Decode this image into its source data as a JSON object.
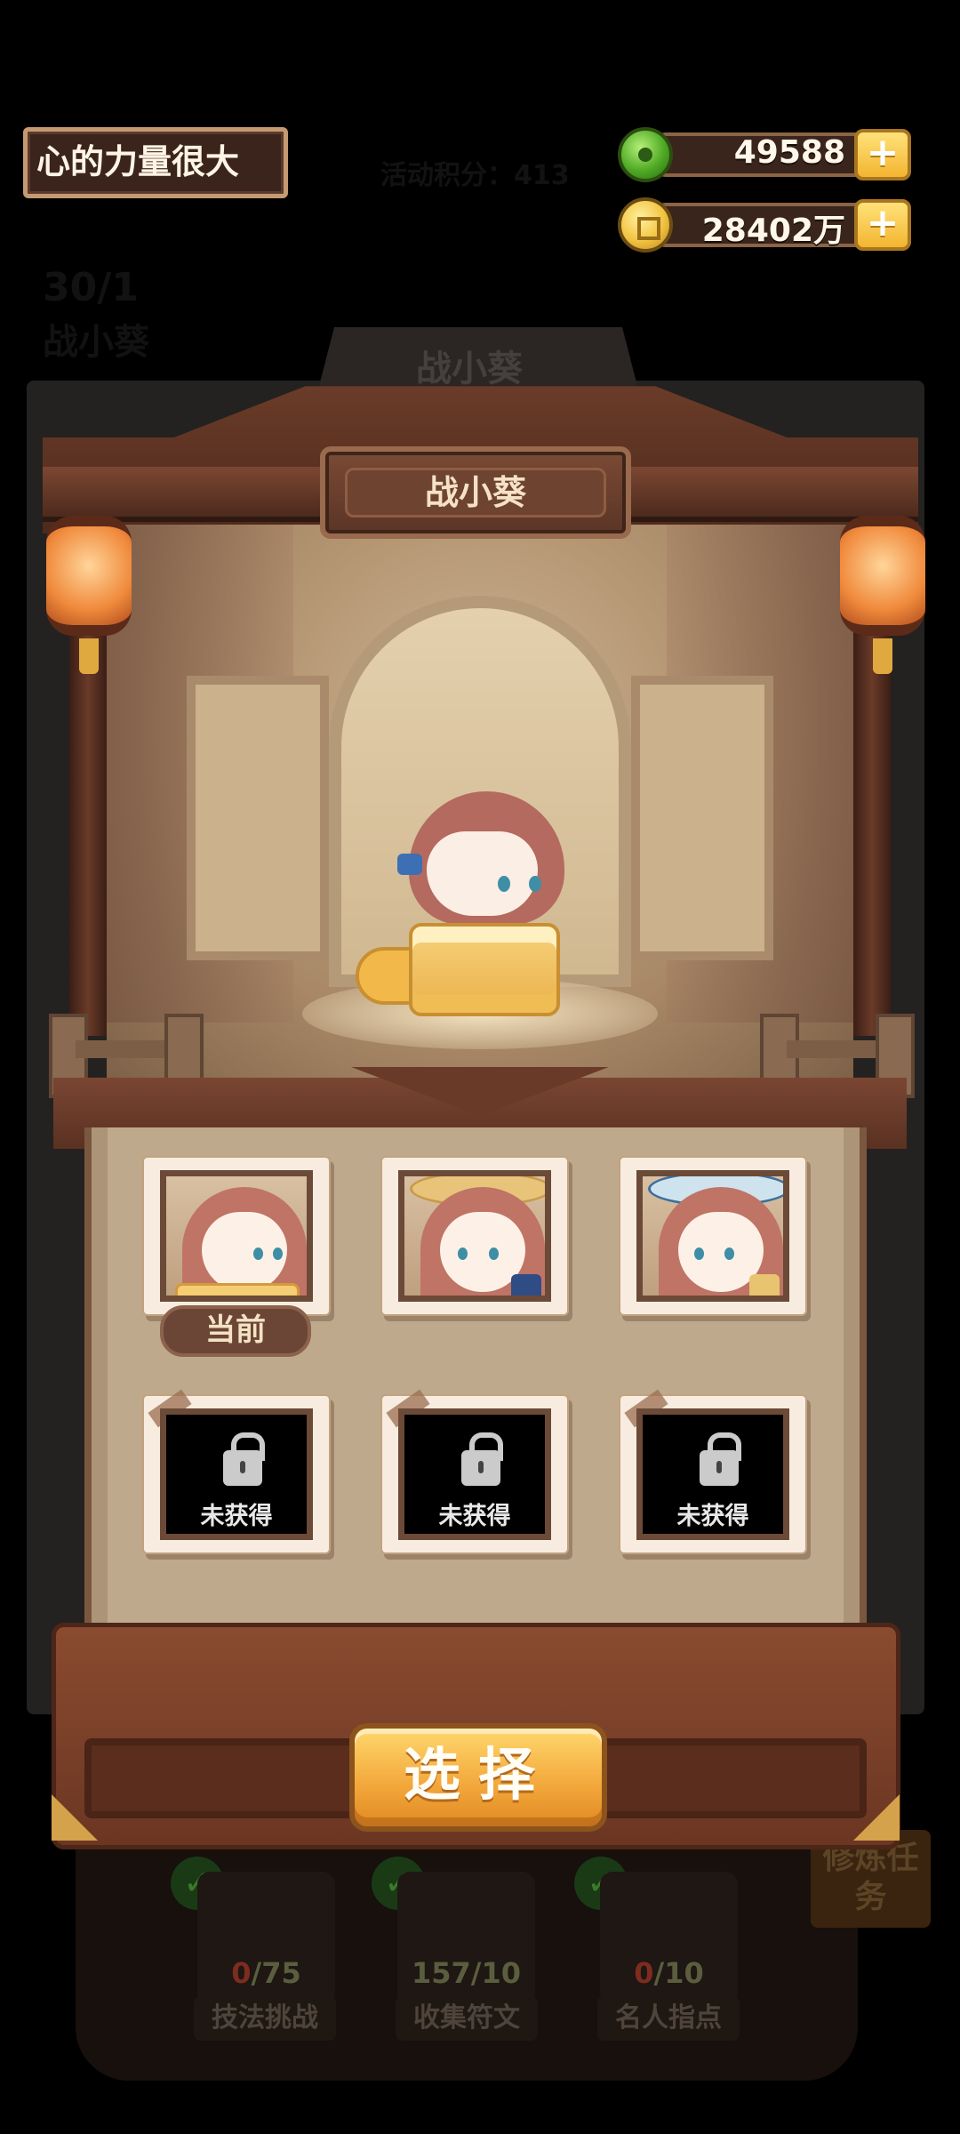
{
  "player": {
    "name": "心的力量很大"
  },
  "currencies": [
    {
      "icon": "jade-coin-icon",
      "value": "49588"
    },
    {
      "icon": "gold-coin-icon",
      "value": "28402万"
    }
  ],
  "background": {
    "header_ghost": "活动积分：413",
    "rank_ghost": "30/1",
    "name_ghost": "战小葵",
    "plate_ghost": "战小葵",
    "side_task": "修炼任务",
    "stats": [
      {
        "label": "技法挑战",
        "current": "0",
        "total": "/75"
      },
      {
        "label": "收集符文",
        "current": "157",
        "total": "/10"
      },
      {
        "label": "名人指点",
        "current": "0",
        "total": "/10"
      }
    ]
  },
  "dialog": {
    "title": "战小葵",
    "current_label": "当前",
    "locked_label": "未获得",
    "select_label": "选择"
  },
  "outfits": [
    {
      "state": "current"
    },
    {
      "state": "owned"
    },
    {
      "state": "owned"
    },
    {
      "state": "locked"
    },
    {
      "state": "locked"
    },
    {
      "state": "locked"
    }
  ],
  "colors": {
    "accent": "#f2a63a",
    "wood": "#6b3622",
    "panel": "#bfa98c"
  }
}
